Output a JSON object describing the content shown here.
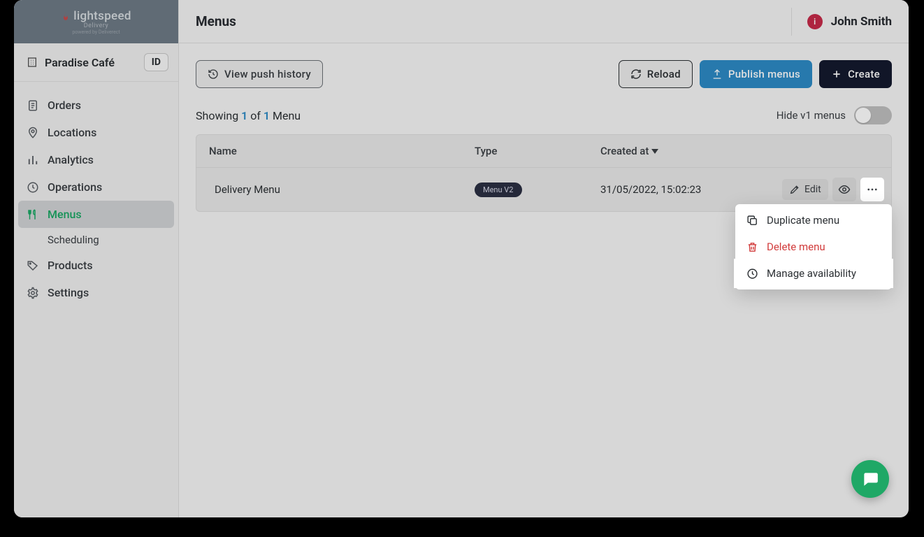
{
  "brand": {
    "name": "lightspeed",
    "sub1": "Delivery",
    "sub2": "powered by Deliverect"
  },
  "cafe": {
    "name": "Paradise Café",
    "badge": "ID"
  },
  "sidebar": {
    "items": [
      {
        "label": "Orders"
      },
      {
        "label": "Locations"
      },
      {
        "label": "Analytics"
      },
      {
        "label": "Operations"
      },
      {
        "label": "Menus"
      },
      {
        "label": "Products"
      },
      {
        "label": "Settings"
      }
    ],
    "sub": {
      "label": "Scheduling"
    }
  },
  "header": {
    "title": "Menus",
    "user": "John Smith",
    "avatar": "i"
  },
  "actions": {
    "push_history": "View push history",
    "reload": "Reload",
    "publish": "Publish menus",
    "create": "Create"
  },
  "info": {
    "showing_prefix": "Showing ",
    "count": "1",
    "of": " of ",
    "total": "1",
    "suffix": " Menu",
    "hide_v1": "Hide v1 menus"
  },
  "table": {
    "cols": {
      "name": "Name",
      "type": "Type",
      "created": "Created at"
    },
    "row": {
      "name": "Delivery Menu",
      "type_badge": "Menu V2",
      "created": "31/05/2022, 15:02:23",
      "edit": "Edit"
    }
  },
  "dropdown": {
    "duplicate": "Duplicate menu",
    "delete": "Delete menu",
    "availability": "Manage availability"
  }
}
